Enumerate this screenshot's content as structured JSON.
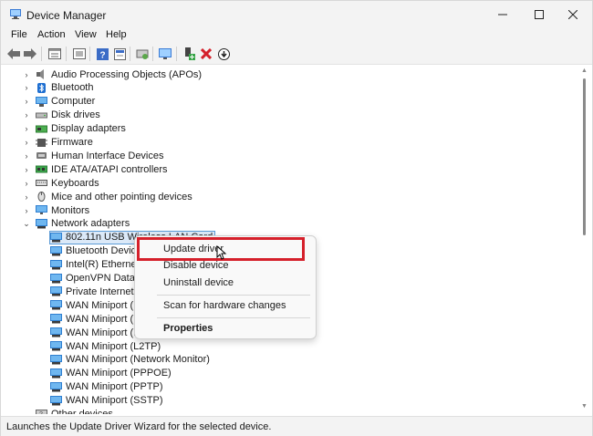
{
  "window": {
    "title": "Device Manager"
  },
  "menubar": [
    "File",
    "Action",
    "View",
    "Help"
  ],
  "toolbar": [
    "back-icon",
    "forward-icon",
    "properties-view-icon",
    "list-view-icon",
    "help-icon",
    "show-hidden-icon",
    "scan-hardware-icon",
    "monitor-icon",
    "add-driver-icon",
    "uninstall-icon",
    "update-driver-icon"
  ],
  "tree": {
    "categories_top": [
      {
        "label": "Audio Processing Objects (APOs)",
        "icon": "speaker-icon"
      },
      {
        "label": "Bluetooth",
        "icon": "bluetooth-icon"
      },
      {
        "label": "Computer",
        "icon": "computer-icon"
      },
      {
        "label": "Disk drives",
        "icon": "disk-icon"
      },
      {
        "label": "Display adapters",
        "icon": "display-adapter-icon"
      },
      {
        "label": "Firmware",
        "icon": "firmware-icon"
      },
      {
        "label": "Human Interface Devices",
        "icon": "hid-icon"
      },
      {
        "label": "IDE ATA/ATAPI controllers",
        "icon": "ide-icon"
      },
      {
        "label": "Keyboards",
        "icon": "keyboard-icon"
      },
      {
        "label": "Mice and other pointing devices",
        "icon": "mouse-icon"
      },
      {
        "label": "Monitors",
        "icon": "monitor-icon"
      },
      {
        "label": "Network adapters",
        "icon": "network-icon"
      }
    ],
    "network_children": [
      "802.11n USB Wireless LAN Card",
      "Bluetooth Device",
      "Intel(R) Ethernet",
      "OpenVPN Data C",
      "Private Internet A",
      "WAN Miniport (I",
      "WAN Miniport (I",
      "WAN Miniport (I",
      "WAN Miniport (L2TP)",
      "WAN Miniport (Network Monitor)",
      "WAN Miniport (PPPOE)",
      "WAN Miniport (PPTP)",
      "WAN Miniport (SSTP)"
    ],
    "after": {
      "label": "Other devices",
      "icon": "other-devices-icon"
    }
  },
  "context_menu": {
    "update": "Update driver",
    "disable": "Disable device",
    "uninstall": "Uninstall device",
    "scan": "Scan for hardware changes",
    "properties": "Properties"
  },
  "status": "Launches the Update Driver Wizard for the selected device.",
  "colors": {
    "highlight": "#d5202b",
    "selection": "#dbe9f8",
    "selection_border": "#5b9bd5",
    "nic_icon": "#2f8fd8"
  }
}
